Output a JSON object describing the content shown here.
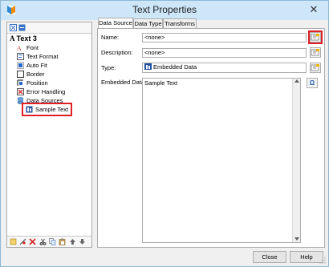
{
  "window": {
    "title": "Text Properties",
    "close_glyph": "✕"
  },
  "tree": {
    "root": "Text 3",
    "items": [
      {
        "label": "Font",
        "icon": "font-icon"
      },
      {
        "label": "Text Format",
        "icon": "text-format-icon"
      },
      {
        "label": "Auto Fit",
        "icon": "auto-fit-icon"
      },
      {
        "label": "Border",
        "icon": "border-icon"
      },
      {
        "label": "Position",
        "icon": "position-icon"
      },
      {
        "label": "Error Handling",
        "icon": "error-handling-icon"
      },
      {
        "label": "Data Sources",
        "icon": "data-sources-icon"
      }
    ],
    "selected_child": {
      "label": "Sample Text",
      "icon": "data-source-item-icon"
    },
    "toolbar_bottom": [
      "new-icon",
      "options-icon",
      "delete-icon",
      "cut-icon",
      "copy-icon",
      "paste-icon",
      "move-up-icon",
      "move-down-icon"
    ]
  },
  "tabs": [
    {
      "label": "Data Source"
    },
    {
      "label": "Data Type"
    },
    {
      "label": "Transforms"
    }
  ],
  "form": {
    "name_label": "Name:",
    "name_value": "<none>",
    "description_label": "Description:",
    "description_value": "<none>",
    "type_label": "Type:",
    "type_value": "Embedded Data",
    "embedded_label": "Embedded Data:",
    "embedded_value": "Sample Text",
    "omega_glyph": "Ω"
  },
  "buttons": {
    "close": "Close",
    "help": "Help"
  },
  "colors": {
    "highlight": "#e01f26",
    "accent": "#1f5fb8"
  }
}
